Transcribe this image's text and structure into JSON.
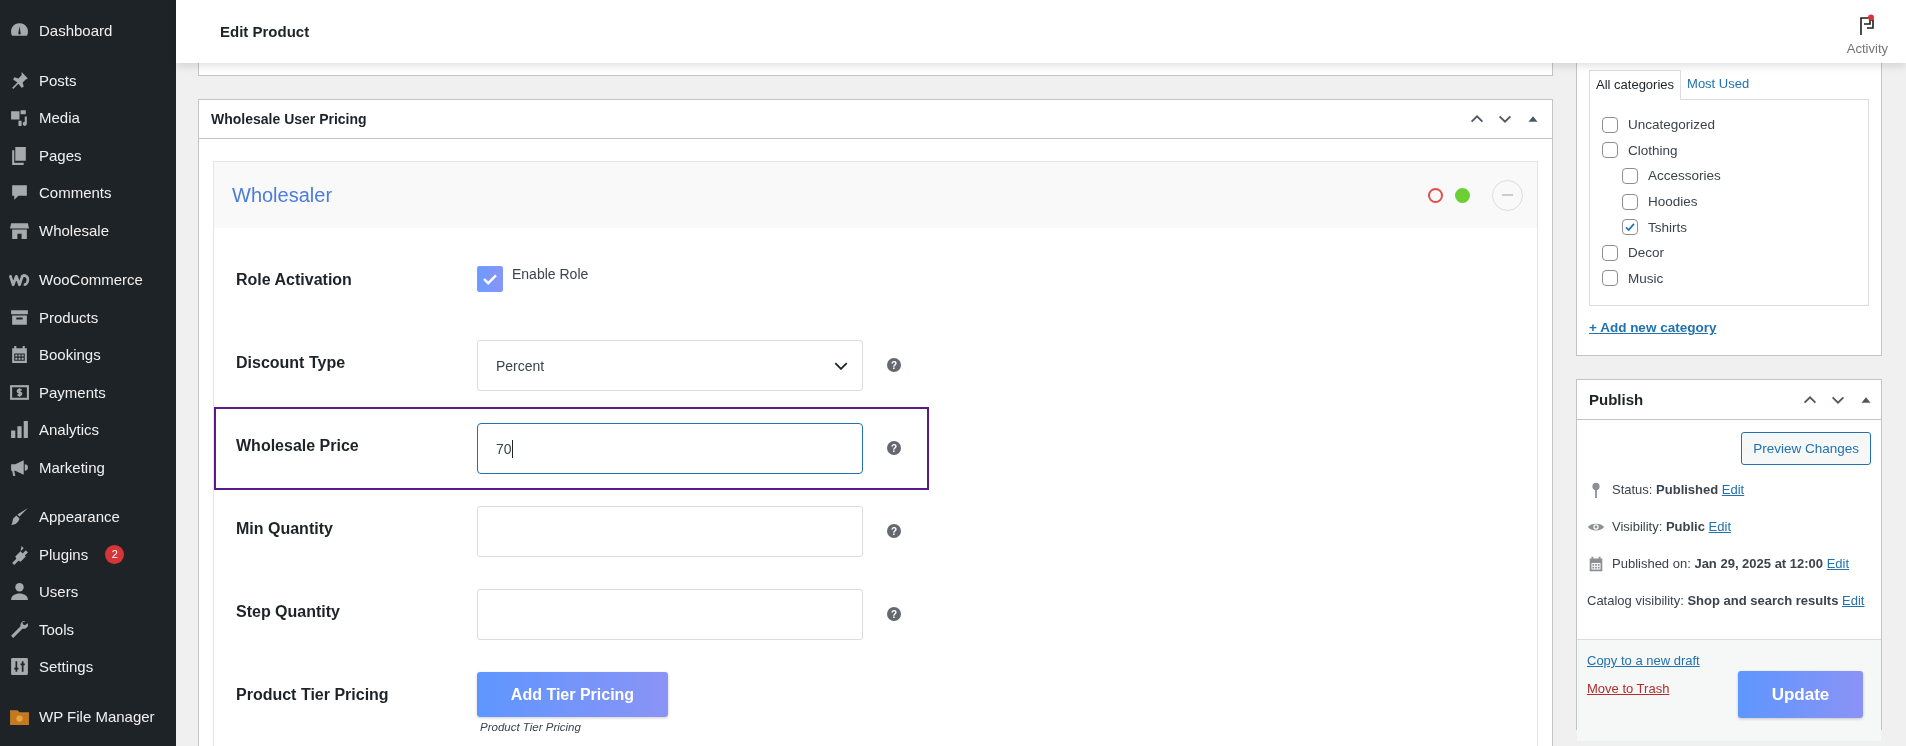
{
  "sidebar": {
    "groups": [
      {
        "items": [
          {
            "label": "Dashboard"
          }
        ]
      },
      {
        "items": [
          {
            "label": "Posts"
          },
          {
            "label": "Media"
          },
          {
            "label": "Pages"
          },
          {
            "label": "Comments"
          },
          {
            "label": "Wholesale"
          }
        ]
      },
      {
        "items": [
          {
            "label": "WooCommerce"
          },
          {
            "label": "Products"
          },
          {
            "label": "Bookings"
          },
          {
            "label": "Payments"
          },
          {
            "label": "Analytics"
          },
          {
            "label": "Marketing"
          }
        ]
      },
      {
        "items": [
          {
            "label": "Appearance"
          },
          {
            "label": "Plugins",
            "badge": "2"
          },
          {
            "label": "Users"
          },
          {
            "label": "Tools"
          },
          {
            "label": "Settings"
          }
        ]
      },
      {
        "items": [
          {
            "label": "WP File Manager"
          }
        ]
      }
    ]
  },
  "header": {
    "title": "Edit Product",
    "activity": {
      "label": "Activity",
      "notification": true
    }
  },
  "pricing_panel": {
    "title": "Wholesale User Pricing",
    "role": {
      "name": "Wholesaler",
      "status_dots": [
        {
          "color": "#e2504c",
          "filled": false
        },
        {
          "color": "#6ccf34",
          "filled": true
        }
      ]
    },
    "fields": [
      {
        "kind": "checkbox",
        "label": "Role Activation",
        "option": "Enable Role",
        "checked": true
      },
      {
        "kind": "select",
        "label": "Discount Type",
        "value": "Percent",
        "help": "?"
      },
      {
        "kind": "input",
        "label": "Wholesale Price",
        "value": "70",
        "help": "?",
        "highlighted": true,
        "focused": true
      },
      {
        "kind": "input",
        "label": "Min Quantity",
        "help": "?",
        "focused": false
      },
      {
        "kind": "input",
        "label": "Step Quantity",
        "help": "?",
        "focused": false
      },
      {
        "kind": "button",
        "label": "Product Tier Pricing",
        "button": "Add Tier Pricing",
        "caption": "Product Tier Pricing"
      }
    ]
  },
  "categories": {
    "tabs": [
      {
        "label": "All categories",
        "selected": true
      },
      {
        "label": "Most Used",
        "selected": false
      }
    ],
    "items": [
      {
        "label": "Uncategorized",
        "checked": false
      },
      {
        "label": "Clothing",
        "checked": false,
        "children": [
          {
            "label": "Accessories",
            "checked": false
          },
          {
            "label": "Hoodies",
            "checked": false
          },
          {
            "label": "Tshirts",
            "checked": true
          }
        ]
      },
      {
        "label": "Decor",
        "checked": false
      },
      {
        "label": "Music",
        "checked": false
      }
    ],
    "add_link": "+ Add new category"
  },
  "publish": {
    "title": "Publish",
    "preview_button": "Preview Changes",
    "rows": [
      {
        "kind": "status",
        "label": "Status:",
        "value": "Published",
        "link": "Edit"
      },
      {
        "kind": "visibility",
        "label": "Visibility:",
        "value": "Public",
        "link": "Edit"
      },
      {
        "kind": "date",
        "label": "Published on:",
        "value": "Jan 29, 2025 at 12:00",
        "link": "Edit"
      },
      {
        "kind": "catalog",
        "label": "Catalog visibility:",
        "value": "Shop and search results",
        "link": "Edit"
      }
    ],
    "copy_link": "Copy to a new draft",
    "trash_link": "Move to Trash",
    "update_button": "Update"
  }
}
